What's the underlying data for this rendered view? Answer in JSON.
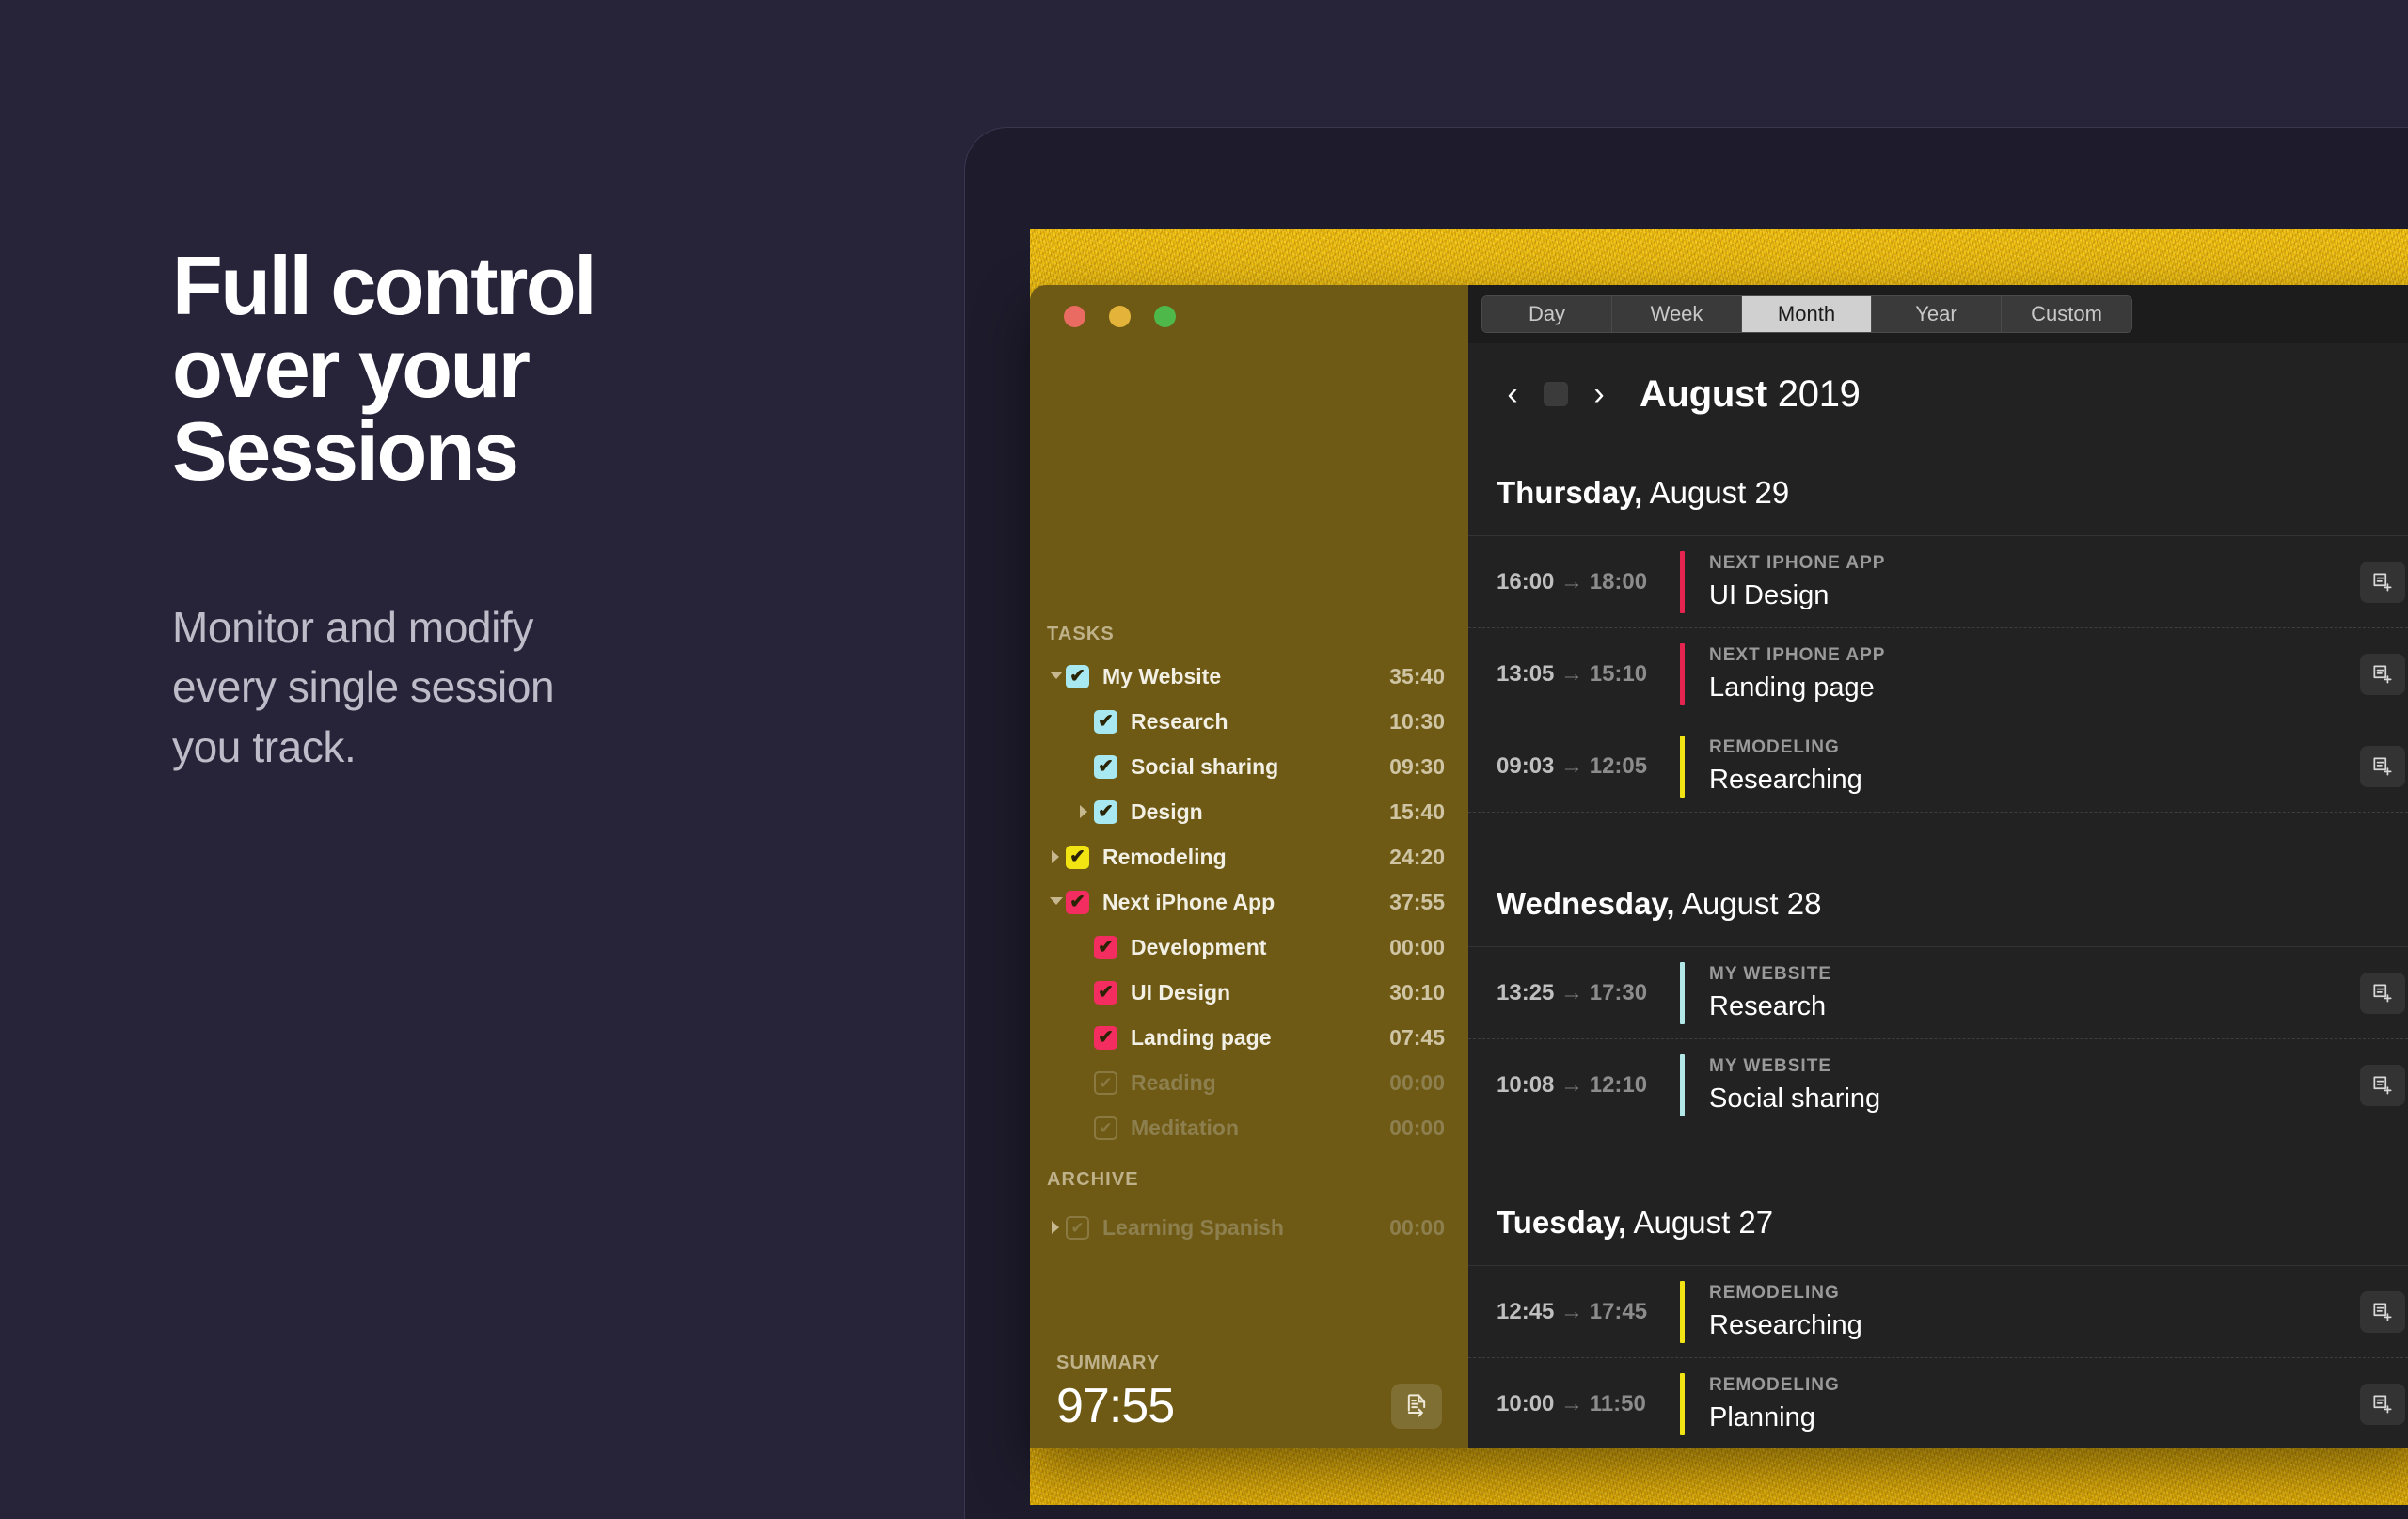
{
  "promo": {
    "headline": "Full control\nover your\nSessions",
    "subhead": "Monitor and modify\nevery single session\nyou track."
  },
  "window": {
    "traffic_lights": [
      "close",
      "minimize",
      "maximize"
    ]
  },
  "sidebar": {
    "tasks_label": "TASKS",
    "archive_label": "ARCHIVE",
    "tasks": [
      {
        "name": "My Website",
        "time": "35:40",
        "color": "cyan",
        "disclosure": "down",
        "indent": 0,
        "dim": false
      },
      {
        "name": "Research",
        "time": "10:30",
        "color": "cyan",
        "disclosure": "none",
        "indent": 1,
        "dim": false
      },
      {
        "name": "Social sharing",
        "time": "09:30",
        "color": "cyan",
        "disclosure": "none",
        "indent": 1,
        "dim": false
      },
      {
        "name": "Design",
        "time": "15:40",
        "color": "cyan",
        "disclosure": "right",
        "indent": 1,
        "dim": false
      },
      {
        "name": "Remodeling",
        "time": "24:20",
        "color": "yellow",
        "disclosure": "right",
        "indent": 0,
        "dim": false
      },
      {
        "name": "Next iPhone App",
        "time": "37:55",
        "color": "pink",
        "disclosure": "down",
        "indent": 0,
        "dim": false
      },
      {
        "name": "Development",
        "time": "00:00",
        "color": "pink",
        "disclosure": "none",
        "indent": 1,
        "dim": false
      },
      {
        "name": "UI Design",
        "time": "30:10",
        "color": "pink",
        "disclosure": "none",
        "indent": 1,
        "dim": false
      },
      {
        "name": "Landing page",
        "time": "07:45",
        "color": "pink",
        "disclosure": "none",
        "indent": 1,
        "dim": false
      },
      {
        "name": "Reading",
        "time": "00:00",
        "color": "ghost",
        "disclosure": "none",
        "indent": 1,
        "dim": true
      },
      {
        "name": "Meditation",
        "time": "00:00",
        "color": "ghost",
        "disclosure": "none",
        "indent": 1,
        "dim": true
      }
    ],
    "archive": [
      {
        "name": "Learning Spanish",
        "time": "00:00",
        "color": "ghost",
        "disclosure": "right",
        "indent": 0,
        "dim": true
      }
    ],
    "summary": {
      "label": "SUMMARY",
      "value": "97:55",
      "export_icon": "document-export-icon"
    }
  },
  "toolbar": {
    "segments": [
      {
        "label": "Day",
        "active": false
      },
      {
        "label": "Week",
        "active": false
      },
      {
        "label": "Month",
        "active": true
      },
      {
        "label": "Year",
        "active": false
      },
      {
        "label": "Custom",
        "active": false
      }
    ]
  },
  "navigation": {
    "prev_icon": "chevron-left-icon",
    "stop_icon": "stop-square-icon",
    "next_icon": "chevron-right-icon",
    "month": "August",
    "year": "2019"
  },
  "colors": {
    "accent_cyan": "#B2E8E8",
    "accent_yellow": "#F2E313",
    "accent_pink": "#E5254F",
    "sidebar_bg": "#6E5A15",
    "main_bg": "#222222",
    "promo_bg": "#27243A"
  },
  "days": [
    {
      "weekday": "Thursday,",
      "date": "August 29",
      "sessions": [
        {
          "start": "16:00",
          "end": "18:00",
          "project": "NEXT IPHONE APP",
          "title": "UI Design",
          "color": "#E5254F",
          "action_icon": "add-note-icon"
        },
        {
          "start": "13:05",
          "end": "15:10",
          "project": "NEXT IPHONE APP",
          "title": "Landing page",
          "color": "#E5254F",
          "action_icon": "add-note-icon"
        },
        {
          "start": "09:03",
          "end": "12:05",
          "project": "REMODELING",
          "title": "Researching",
          "color": "#F2E313",
          "action_icon": "add-note-icon"
        }
      ]
    },
    {
      "weekday": "Wednesday,",
      "date": "August 28",
      "sessions": [
        {
          "start": "13:25",
          "end": "17:30",
          "project": "MY WEBSITE",
          "title": "Research",
          "color": "#B2E8E8",
          "action_icon": "add-note-icon"
        },
        {
          "start": "10:08",
          "end": "12:10",
          "project": "MY WEBSITE",
          "title": "Social sharing",
          "color": "#B2E8E8",
          "action_icon": "add-note-icon"
        }
      ]
    },
    {
      "weekday": "Tuesday,",
      "date": "August 27",
      "sessions": [
        {
          "start": "12:45",
          "end": "17:45",
          "project": "REMODELING",
          "title": "Researching",
          "color": "#F2E313",
          "action_icon": "add-note-icon"
        },
        {
          "start": "10:00",
          "end": "11:50",
          "project": "REMODELING",
          "title": "Planning",
          "color": "#F2E313",
          "action_icon": "add-note-icon"
        }
      ]
    }
  ]
}
